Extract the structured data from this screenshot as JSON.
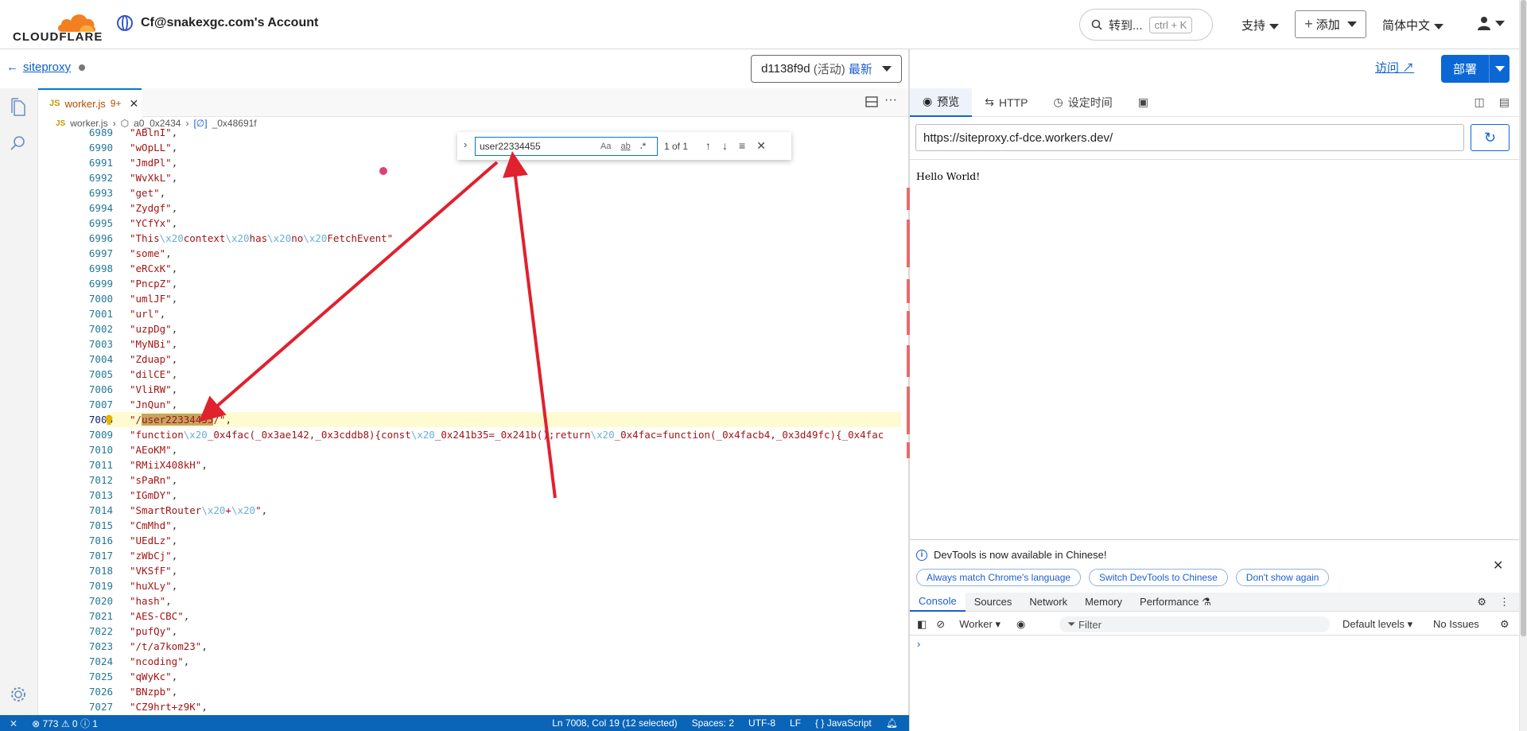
{
  "brand": {
    "name": "CLOUDFLARE",
    "orange": "#f38020"
  },
  "account": {
    "name": "Cf@snakexgc.com's Account"
  },
  "topnav": {
    "search_label": "转到...",
    "search_shortcut": "ctrl + K",
    "support": "支持",
    "add": "添加",
    "language": "简体中文"
  },
  "project": {
    "name": "siteproxy"
  },
  "version": {
    "id": "d1138f9d",
    "state": "(活动)",
    "tag": "最新"
  },
  "editor": {
    "tab": {
      "name": "worker.js",
      "problems": "9+"
    },
    "breadcrumb": [
      "worker.js",
      "a0_0x2434",
      "_0x48691f"
    ],
    "find": {
      "query": "user22334455",
      "case_label": "Aa",
      "word_label": "ab",
      "regex_label": ".*",
      "result": "1 of 1"
    },
    "current_line": "7008",
    "lines": [
      {
        "n": "6989",
        "t": "\"ABlnI\","
      },
      {
        "n": "6990",
        "t": "\"wOpLL\","
      },
      {
        "n": "6991",
        "t": "\"JmdPl\","
      },
      {
        "n": "6992",
        "t": "\"WvXkL\","
      },
      {
        "n": "6993",
        "t": "\"get\","
      },
      {
        "n": "6994",
        "t": "\"Zydgf\","
      },
      {
        "n": "6995",
        "t": "\"YCfYx\","
      },
      {
        "n": "6996",
        "t": "\"This\\x20context\\x20has\\x20no\\x20FetchEvent\""
      },
      {
        "n": "6997",
        "t": "\"some\","
      },
      {
        "n": "6998",
        "t": "\"eRCxK\","
      },
      {
        "n": "6999",
        "t": "\"PncpZ\","
      },
      {
        "n": "7000",
        "t": "\"umlJF\","
      },
      {
        "n": "7001",
        "t": "\"url\","
      },
      {
        "n": "7002",
        "t": "\"uzpDg\","
      },
      {
        "n": "7003",
        "t": "\"MyNBi\","
      },
      {
        "n": "7004",
        "t": "\"Zduap\","
      },
      {
        "n": "7005",
        "t": "\"dilCE\","
      },
      {
        "n": "7006",
        "t": "\"VliRW\","
      },
      {
        "n": "7007",
        "t": "\"JnQun\","
      },
      {
        "n": "7008",
        "t": "\"/user22334455/\","
      },
      {
        "n": "7009",
        "t": "\"function\\x20_0x4fac(_0x3ae142,_0x3cddb8){const\\x20_0x241b35=_0x241b();return\\x20_0x4fac=function(_0x4facb4,_0x3d49fc){_0x4fac"
      },
      {
        "n": "7010",
        "t": "\"AEoKM\","
      },
      {
        "n": "7011",
        "t": "\"RMiiX408kH\","
      },
      {
        "n": "7012",
        "t": "\"sPaRn\","
      },
      {
        "n": "7013",
        "t": "\"IGmDY\","
      },
      {
        "n": "7014",
        "t": "\"SmartRouter\\x20+\\x20\","
      },
      {
        "n": "7015",
        "t": "\"CmMhd\","
      },
      {
        "n": "7016",
        "t": "\"UEdLz\","
      },
      {
        "n": "7017",
        "t": "\"zWbCj\","
      },
      {
        "n": "7018",
        "t": "\"VKSfF\","
      },
      {
        "n": "7019",
        "t": "\"huXLy\","
      },
      {
        "n": "7020",
        "t": "\"hash\","
      },
      {
        "n": "7021",
        "t": "\"AES-CBC\","
      },
      {
        "n": "7022",
        "t": "\"pufQy\","
      },
      {
        "n": "7023",
        "t": "\"/t/a7kom23\","
      },
      {
        "n": "7024",
        "t": "\"ncoding\","
      },
      {
        "n": "7025",
        "t": "\"qWyKc\","
      },
      {
        "n": "7026",
        "t": "\"BNzpb\","
      },
      {
        "n": "7027",
        "t": "\"CZ9hrt+z9K\","
      }
    ],
    "status": {
      "problems": "773",
      "warnings": "0",
      "infos": "1",
      "cursor": "Ln 7008, Col 19 (12 selected)",
      "spaces": "Spaces: 2",
      "encoding": "UTF-8",
      "eol": "LF",
      "language": "JavaScript"
    }
  },
  "preview_panel": {
    "visit": "访问",
    "deploy": "部署",
    "tabs": [
      "预览",
      "HTTP",
      "设定时间"
    ],
    "url": "https://siteproxy.cf-dce.workers.dev/",
    "body_text": "Hello World!"
  },
  "devtools": {
    "notice": "DevTools is now available in Chinese!",
    "buttons": [
      "Always match Chrome's language",
      "Switch DevTools to Chinese",
      "Don't show again"
    ],
    "tabs": [
      "Console",
      "Sources",
      "Network",
      "Memory",
      "Performance"
    ],
    "context": "Worker",
    "filter_placeholder": "Filter",
    "levels": "Default levels",
    "issues": "No Issues",
    "prompt": "›"
  },
  "colors": {
    "accent": "#0a67d4",
    "statusbar": "#0a65b9",
    "annotation_arrow": "#e0212e",
    "find_highlight": "#c6a560"
  }
}
